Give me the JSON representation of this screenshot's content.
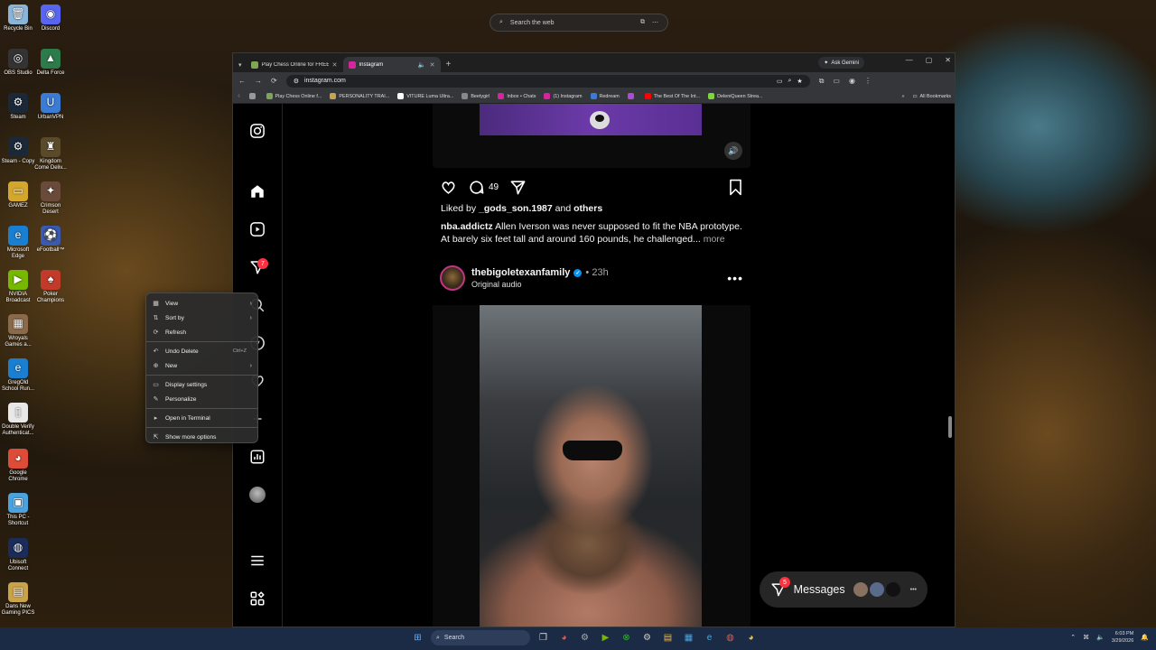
{
  "desktop": {
    "icons": [
      {
        "label": "Recycle Bin",
        "glyph": "🗑",
        "color": "#8ab4d8"
      },
      {
        "label": "Discord",
        "glyph": "◉",
        "color": "#5865f2"
      },
      {
        "label": "OBS Studio",
        "glyph": "◎",
        "color": "#333333"
      },
      {
        "label": "Delta Force",
        "glyph": "▲",
        "color": "#2d7a4a"
      },
      {
        "label": "Steam",
        "glyph": "⚙",
        "color": "#1b2838"
      },
      {
        "label": "UrbanVPN",
        "glyph": "U",
        "color": "#3a7bd5"
      },
      {
        "label": "Steam - Copy",
        "glyph": "⚙",
        "color": "#1b2838"
      },
      {
        "label": "Kingdom Come Deliv...",
        "glyph": "♜",
        "color": "#5a4a2a"
      },
      {
        "label": "GAMEZ",
        "glyph": "▭",
        "color": "#d4a72c"
      },
      {
        "label": "Crimson Desert",
        "glyph": "✦",
        "color": "#6a4a3a"
      },
      {
        "label": "Microsoft Edge",
        "glyph": "e",
        "color": "#1a7fd1"
      },
      {
        "label": "eFootball™",
        "glyph": "⚽",
        "color": "#3a5ab0"
      },
      {
        "label": "NVIDIA Broadcast",
        "glyph": "▶",
        "color": "#76b900"
      },
      {
        "label": "Poker Champions",
        "glyph": "♠",
        "color": "#c23a2a"
      },
      {
        "label": "Wroyals Games a...",
        "glyph": "▦",
        "color": "#8a6a4a"
      },
      {
        "label": "GregOld School Run...",
        "glyph": "e",
        "color": "#1a7fd1"
      },
      {
        "label": "Double Verify Authenticat...",
        "glyph": "▯",
        "color": "#e8e8e8"
      },
      {
        "label": "Google Chrome",
        "glyph": "◕",
        "color": "#dd4b39"
      },
      {
        "label": "This PC - Shortcut",
        "glyph": "▣",
        "color": "#4aa3df"
      },
      {
        "label": "Ubisoft Connect",
        "glyph": "◍",
        "color": "#1b2b5a"
      },
      {
        "label": "Dans New Gaming PICS",
        "glyph": "▤",
        "color": "#c9a24a"
      }
    ]
  },
  "web_search": {
    "placeholder": "Search the web"
  },
  "browser": {
    "tabs": [
      {
        "label": "Play Chess Online for FREE - 2 ...",
        "active": false,
        "color": "#7fa650"
      },
      {
        "label": "Instagram",
        "active": true,
        "color": "#d6249f"
      }
    ],
    "new_tab": "+",
    "gemini": "Ask Gemini",
    "url": "instagram.com",
    "bookmarks": [
      {
        "label": "",
        "color": "#999999"
      },
      {
        "label": "Play Chess Online f...",
        "color": "#7fa650"
      },
      {
        "label": "PERSONALITY TRAI...",
        "color": "#c9a24a"
      },
      {
        "label": "VITURE Luma Ultra...",
        "color": "#ffffff"
      },
      {
        "label": "Beetygirl",
        "color": "#888888"
      },
      {
        "label": "Inbox • Chats",
        "color": "#d6249f"
      },
      {
        "label": "(1) Instagram",
        "color": "#d6249f"
      },
      {
        "label": "Redream",
        "color": "#3a7bd5"
      },
      {
        "label": "",
        "color": "#b04ad6"
      },
      {
        "label": "The Best Of The Int...",
        "color": "#ff0000"
      },
      {
        "label": "DeleniQueen Strea...",
        "color": "#7fd63a"
      }
    ],
    "all_bookmarks": "All Bookmarks"
  },
  "instagram": {
    "notifications_badge": "7",
    "post1": {
      "comment_count": "49",
      "likes_prefix": "Liked by ",
      "likes_user": "_gods_son.1987",
      "likes_and": " and ",
      "likes_others": "others",
      "caption_user": "nba.addictz",
      "caption_text": " Allen Iverson was never supposed to fit the NBA prototype. At barely six feet tall and around 160 pounds, he challenged...",
      "more": " more"
    },
    "post2": {
      "username": "thebigoletexanfamily",
      "time": "• 23h",
      "audio": "Original audio",
      "options": "•••"
    },
    "messages": {
      "label": "Messages",
      "badge": "5",
      "more": "•••"
    }
  },
  "context_menu": {
    "items": [
      {
        "label": "View",
        "icon": "▦",
        "shortcut": "",
        "arrow": "›"
      },
      {
        "label": "Sort by",
        "icon": "⇅",
        "shortcut": "",
        "arrow": "›"
      },
      {
        "label": "Refresh",
        "icon": "⟳",
        "shortcut": "",
        "arrow": ""
      },
      {
        "label": "Undo Delete",
        "icon": "↶",
        "shortcut": "Ctrl+Z",
        "arrow": ""
      },
      {
        "label": "New",
        "icon": "⊕",
        "shortcut": "",
        "arrow": "›"
      },
      {
        "label": "Display settings",
        "icon": "▭",
        "shortcut": "",
        "arrow": ""
      },
      {
        "label": "Personalize",
        "icon": "✎",
        "shortcut": "",
        "arrow": ""
      },
      {
        "label": "Open in Terminal",
        "icon": "▸",
        "shortcut": "",
        "arrow": ""
      },
      {
        "label": "Show more options",
        "icon": "⇱",
        "shortcut": "",
        "arrow": ""
      }
    ]
  },
  "taskbar": {
    "search": "Search",
    "time": "6:03 PM",
    "date": "3/29/2026"
  }
}
